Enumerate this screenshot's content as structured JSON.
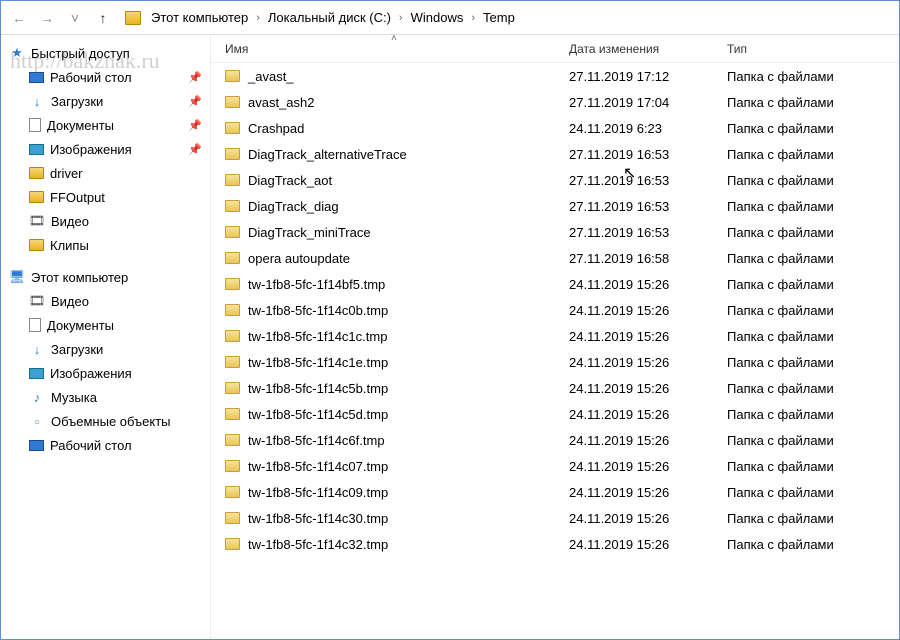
{
  "watermark": "http://bakznak.ru",
  "breadcrumb": {
    "items": [
      "Этот компьютер",
      "Локальный диск (C:)",
      "Windows",
      "Temp"
    ]
  },
  "columns": {
    "name": "Имя",
    "date": "Дата изменения",
    "type": "Тип"
  },
  "sidebar": {
    "quick_access": "Быстрый доступ",
    "quick_items": [
      {
        "label": "Рабочий стол",
        "icon": "desktop",
        "pinned": true
      },
      {
        "label": "Загрузки",
        "icon": "download",
        "pinned": true
      },
      {
        "label": "Документы",
        "icon": "document",
        "pinned": true
      },
      {
        "label": "Изображения",
        "icon": "pictures",
        "pinned": true
      },
      {
        "label": "driver",
        "icon": "folder",
        "pinned": false
      },
      {
        "label": "FFOutput",
        "icon": "folder",
        "pinned": false
      },
      {
        "label": "Видео",
        "icon": "video",
        "pinned": false
      },
      {
        "label": "Клипы",
        "icon": "folder",
        "pinned": false
      }
    ],
    "this_pc": "Этот компьютер",
    "pc_items": [
      {
        "label": "Видео",
        "icon": "video"
      },
      {
        "label": "Документы",
        "icon": "document"
      },
      {
        "label": "Загрузки",
        "icon": "download"
      },
      {
        "label": "Изображения",
        "icon": "pictures"
      },
      {
        "label": "Музыка",
        "icon": "music"
      },
      {
        "label": "Объемные объекты",
        "icon": "obj"
      },
      {
        "label": "Рабочий стол",
        "icon": "desktop"
      }
    ]
  },
  "files": [
    {
      "name": "_avast_",
      "date": "27.11.2019 17:12",
      "type": "Папка с файлами"
    },
    {
      "name": "avast_ash2",
      "date": "27.11.2019 17:04",
      "type": "Папка с файлами"
    },
    {
      "name": "Crashpad",
      "date": "24.11.2019 6:23",
      "type": "Папка с файлами"
    },
    {
      "name": "DiagTrack_alternativeTrace",
      "date": "27.11.2019 16:53",
      "type": "Папка с файлами"
    },
    {
      "name": "DiagTrack_aot",
      "date": "27.11.2019 16:53",
      "type": "Папка с файлами"
    },
    {
      "name": "DiagTrack_diag",
      "date": "27.11.2019 16:53",
      "type": "Папка с файлами"
    },
    {
      "name": "DiagTrack_miniTrace",
      "date": "27.11.2019 16:53",
      "type": "Папка с файлами"
    },
    {
      "name": "opera autoupdate",
      "date": "27.11.2019 16:58",
      "type": "Папка с файлами"
    },
    {
      "name": "tw-1fb8-5fc-1f14bf5.tmp",
      "date": "24.11.2019 15:26",
      "type": "Папка с файлами"
    },
    {
      "name": "tw-1fb8-5fc-1f14c0b.tmp",
      "date": "24.11.2019 15:26",
      "type": "Папка с файлами"
    },
    {
      "name": "tw-1fb8-5fc-1f14c1c.tmp",
      "date": "24.11.2019 15:26",
      "type": "Папка с файлами"
    },
    {
      "name": "tw-1fb8-5fc-1f14c1e.tmp",
      "date": "24.11.2019 15:26",
      "type": "Папка с файлами"
    },
    {
      "name": "tw-1fb8-5fc-1f14c5b.tmp",
      "date": "24.11.2019 15:26",
      "type": "Папка с файлами"
    },
    {
      "name": "tw-1fb8-5fc-1f14c5d.tmp",
      "date": "24.11.2019 15:26",
      "type": "Папка с файлами"
    },
    {
      "name": "tw-1fb8-5fc-1f14c6f.tmp",
      "date": "24.11.2019 15:26",
      "type": "Папка с файлами"
    },
    {
      "name": "tw-1fb8-5fc-1f14c07.tmp",
      "date": "24.11.2019 15:26",
      "type": "Папка с файлами"
    },
    {
      "name": "tw-1fb8-5fc-1f14c09.tmp",
      "date": "24.11.2019 15:26",
      "type": "Папка с файлами"
    },
    {
      "name": "tw-1fb8-5fc-1f14c30.tmp",
      "date": "24.11.2019 15:26",
      "type": "Папка с файлами"
    },
    {
      "name": "tw-1fb8-5fc-1f14c32.tmp",
      "date": "24.11.2019 15:26",
      "type": "Папка с файлами"
    }
  ],
  "icons": {
    "pin": "📌",
    "back": "←",
    "fwd": "→",
    "up": "↑",
    "dd": "˅",
    "sort": "˄",
    "star": "★",
    "pc": "🖥",
    "video": "🎞",
    "music": "♪",
    "download": "↓",
    "obj": "▫"
  }
}
